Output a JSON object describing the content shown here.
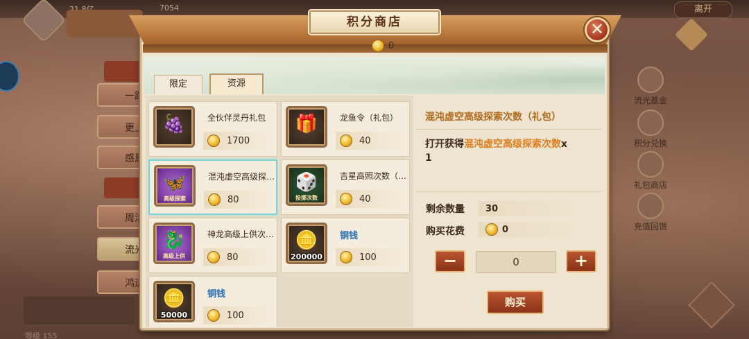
{
  "background": {
    "resource_1": "21.8亿",
    "resource_2": "7054",
    "exit_label": "离开",
    "left_menu": [
      "一路",
      "更上",
      "感恩",
      "周活",
      "流光",
      "鸿运"
    ],
    "level_text": "等级 155",
    "right_menu": [
      {
        "label": "流光基金",
        "icon": "fund-icon"
      },
      {
        "label": "积分兑换",
        "icon": "exchange-icon"
      },
      {
        "label": "礼包商店",
        "icon": "gift-shop-icon"
      },
      {
        "label": "充值回馈",
        "icon": "recharge-icon"
      }
    ]
  },
  "shop": {
    "title": "积分商店",
    "points": "0",
    "tabs": [
      {
        "label": "限定",
        "active": false
      },
      {
        "label": "资源",
        "active": true
      }
    ],
    "items": [
      {
        "name": "全伙伴灵丹礼包",
        "price": "1700",
        "icon": "elixir-pack-icon",
        "glyph": "🍇",
        "frame": "dark",
        "tag": "",
        "qty": "",
        "name_style": "normal"
      },
      {
        "name": "龙鱼令（礼包）",
        "price": "40",
        "icon": "gift-box-icon",
        "glyph": "🎁",
        "frame": "dark",
        "tag": "",
        "qty": "",
        "name_style": "normal"
      },
      {
        "name": "混沌虚空高级探索次数（礼包）",
        "price": "80",
        "icon": "explore-bird-icon",
        "glyph": "🦋",
        "frame": "purple",
        "tag": "高级探索",
        "qty": "",
        "name_style": "normal",
        "selected": true
      },
      {
        "name": "吉星高照次数（礼包）",
        "price": "40",
        "icon": "dice-icon",
        "glyph": "🎲",
        "frame": "green",
        "tag": "投掷次数",
        "qty": "",
        "name_style": "normal"
      },
      {
        "name": "神龙高级上供次数（礼包）",
        "price": "80",
        "icon": "dragon-offering-icon",
        "glyph": "🐉",
        "frame": "purple",
        "tag": "高级上供",
        "qty": "",
        "name_style": "normal"
      },
      {
        "name": "铜钱",
        "price": "100",
        "icon": "copper-coin-icon",
        "glyph": "🪙",
        "frame": "dark",
        "tag": "",
        "qty": "200000",
        "name_style": "blue"
      },
      {
        "name": "铜钱",
        "price": "100",
        "icon": "copper-coin-icon",
        "glyph": "🪙",
        "frame": "dark",
        "tag": "",
        "qty": "50000",
        "name_style": "blue"
      }
    ],
    "detail": {
      "title": "混沌虚空高级探索次数（礼包）",
      "desc_prefix": "打开获得",
      "desc_highlight": "混沌虚空高级探索次数",
      "desc_suffix": "x",
      "desc_count": "1",
      "remaining_label": "剩余数量",
      "remaining_value": "30",
      "cost_label": "购买花费",
      "cost_value": "0",
      "minus_label": "−",
      "plus_label": "+",
      "quantity": "0",
      "buy_label": "购买"
    }
  },
  "colors": {
    "highlight_orange": "#e07d1c",
    "title_orange": "#b06a1c",
    "coin_name_blue": "#2b6fb5",
    "selected_border": "#7ed2d6",
    "button_red": "#8a3418"
  }
}
